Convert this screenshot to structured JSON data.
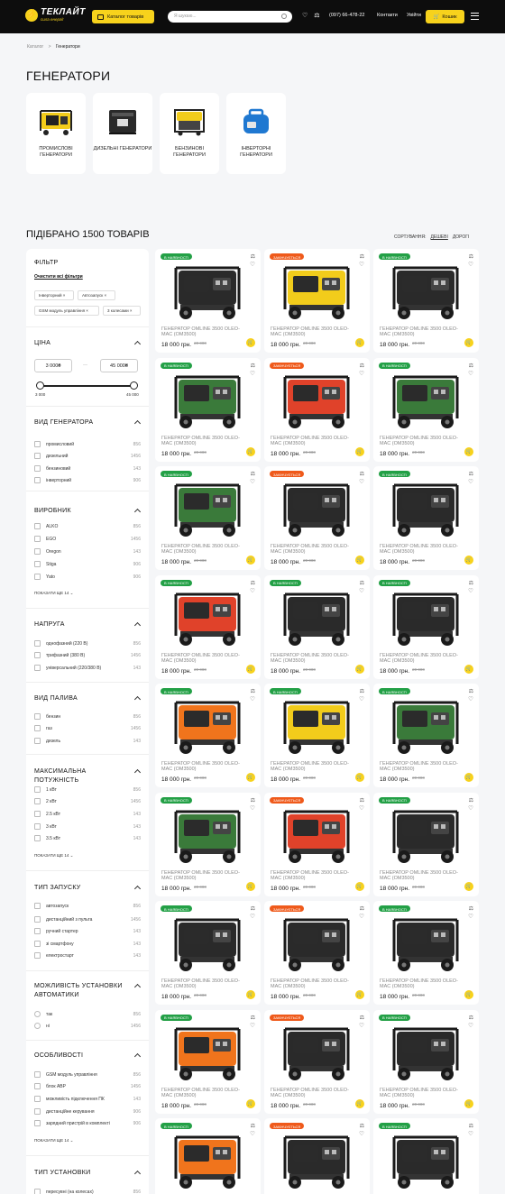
{
  "header": {
    "logo_name": "ТЕКЛАЙТ",
    "logo_slogan": "сила енергії",
    "catalog_label": "Каталог товарів",
    "search_placeholder": "Я шукаю...",
    "phone": "(097) 66-478-22",
    "contacts": "Контакти",
    "login": "Увійти",
    "cart_label": "Кошик"
  },
  "breadcrumb": {
    "root": "Каталог",
    "sep": ">",
    "current": "Генератори"
  },
  "page_title": "ГЕНЕРАТОРИ",
  "categories": [
    {
      "label": "ПРОМИСЛОВІ ГЕНЕРАТОРИ",
      "icon": "industrial-generator-image"
    },
    {
      "label": "ДИЗЕЛЬНІ ГЕНЕРАТОРИ",
      "icon": "diesel-generator-image"
    },
    {
      "label": "БЕНЗИНОВІ ГЕНЕРАТОРИ",
      "icon": "petrol-generator-image"
    },
    {
      "label": "ІНВЕРТОРНІ ГЕНЕРАТОРИ",
      "icon": "inverter-generator-image"
    }
  ],
  "results_count": "ПІДІБРАНО 1500 ТОВАРІВ",
  "sort": {
    "label": "СОРТУВАННЯ:",
    "cheap": "ДЕШЕВІ",
    "expensive": "ДОРОГІ"
  },
  "filter": {
    "title": "ФІЛЬТР",
    "clear": "Очистити всі фільтри",
    "chips": [
      "Інверторний",
      "Автозапуск",
      "GSM модуль управління",
      "3 колесами"
    ],
    "price_title": "ЦІНА",
    "price_from": "3 000₴",
    "price_to": "45 000₴",
    "price_min": "3 000",
    "price_max": "45 000",
    "show_more": "ПОКАЗАТИ ЩЕ 14",
    "groups": [
      {
        "title": "ВИД ГЕНЕРАТОРА",
        "items": [
          [
            "промисловий",
            "856"
          ],
          [
            "дизельний",
            "1456"
          ],
          [
            "бензиновий",
            "143"
          ],
          [
            "інверторний",
            "906"
          ]
        ]
      },
      {
        "title": "ВИРОБНИК",
        "items": [
          [
            "ALKO",
            "856"
          ],
          [
            "EGO",
            "1456"
          ],
          [
            "Oregon",
            "143"
          ],
          [
            "Stiga",
            "906"
          ],
          [
            "Yato",
            "906"
          ]
        ]
      },
      {
        "title": "НАПРУГА",
        "items": [
          [
            "однофазний (220 В)",
            "856"
          ],
          [
            "трифазний (380 В)",
            "1456"
          ],
          [
            "універсальний (220/380 В)",
            "143"
          ]
        ]
      },
      {
        "title": "ВИД ПАЛИВА",
        "items": [
          [
            "бензин",
            "856"
          ],
          [
            "газ",
            "1456"
          ],
          [
            "дизель",
            "143"
          ]
        ]
      },
      {
        "title": "МАКСИМАЛЬНА ПОТУЖНІСТЬ",
        "items": [
          [
            "1 кВт",
            "856"
          ],
          [
            "2 кВт",
            "1456"
          ],
          [
            "2.5 кВт",
            "143"
          ],
          [
            "3 кВт",
            "143"
          ],
          [
            "3.5 кВт",
            "143"
          ]
        ]
      },
      {
        "title": "ТИП ЗАПУСКУ",
        "items": [
          [
            "автозапуск",
            "856"
          ],
          [
            "дистанційний з пульта",
            "1456"
          ],
          [
            "ручний стартер",
            "143"
          ],
          [
            "зі смартфону",
            "143"
          ],
          [
            "електростарт",
            "143"
          ]
        ]
      },
      {
        "title": "МОЖЛИВІСТЬ УСТАНОВКИ АВТОМАТИКИ",
        "items": [
          [
            "так",
            "856"
          ],
          [
            "ні",
            "1456"
          ]
        ]
      },
      {
        "title": "ОСОБЛИВОСТІ",
        "items": [
          [
            "GSM модуль управління",
            "856"
          ],
          [
            "блок АВР",
            "1456"
          ],
          [
            "можливість підключення ПК",
            "143"
          ],
          [
            "дистанційне керування",
            "906"
          ],
          [
            "зарядний пристрій в комплекті",
            "906"
          ]
        ]
      },
      {
        "title": "ТИП УСТАНОВКИ",
        "items": [
          [
            "пересувні (на колесах)",
            "856"
          ]
        ]
      }
    ]
  },
  "product_common": {
    "name": "ГЕНЕРАТОР OMLINE 3500 OLEO-MAC (OM3500)",
    "price": "18 000 грн.",
    "old_price": "20 000",
    "in_stock": "В НАЯВНОСТІ",
    "ending": "ЗАКІНЧУЄТЬСЯ"
  },
  "products": [
    {
      "status": "in_stock",
      "color": "#2a2a2a"
    },
    {
      "status": "ending",
      "color": "#f2cc1b"
    },
    {
      "status": "in_stock",
      "color": "#2a2a2a"
    },
    {
      "status": "in_stock",
      "color": "#3a7a3a"
    },
    {
      "status": "ending",
      "color": "#e0422a"
    },
    {
      "status": "in_stock",
      "color": "#3a7a3a"
    },
    {
      "status": "in_stock",
      "color": "#3a7a3a"
    },
    {
      "status": "ending",
      "color": "#2a2a2a"
    },
    {
      "status": "in_stock",
      "color": "#2a2a2a"
    },
    {
      "status": "in_stock",
      "color": "#e0422a"
    },
    {
      "status": "in_stock",
      "color": "#2a2a2a"
    },
    {
      "status": "in_stock",
      "color": "#2a2a2a"
    },
    {
      "status": "in_stock",
      "color": "#f0741c"
    },
    {
      "status": "in_stock",
      "color": "#f2cc1b"
    },
    {
      "status": "in_stock",
      "color": "#3a7a3a"
    },
    {
      "status": "in_stock",
      "color": "#3a7a3a"
    },
    {
      "status": "ending",
      "color": "#e0422a"
    },
    {
      "status": "in_stock",
      "color": "#2a2a2a"
    },
    {
      "status": "in_stock",
      "color": "#2a2a2a"
    },
    {
      "status": "ending",
      "color": "#2a2a2a"
    },
    {
      "status": "in_stock",
      "color": "#2a2a2a"
    },
    {
      "status": "in_stock",
      "color": "#f0741c"
    },
    {
      "status": "ending",
      "color": "#2a2a2a"
    },
    {
      "status": "in_stock",
      "color": "#2a2a2a"
    },
    {
      "status": "in_stock",
      "color": "#f0741c"
    },
    {
      "status": "ending",
      "color": "#2a2a2a"
    },
    {
      "status": "in_stock",
      "color": "#2a2a2a"
    }
  ],
  "colors": {
    "accent": "#f7d21c",
    "header": "#0d0d0d",
    "in_stock": "#23a046",
    "ending": "#ef5a1b"
  }
}
